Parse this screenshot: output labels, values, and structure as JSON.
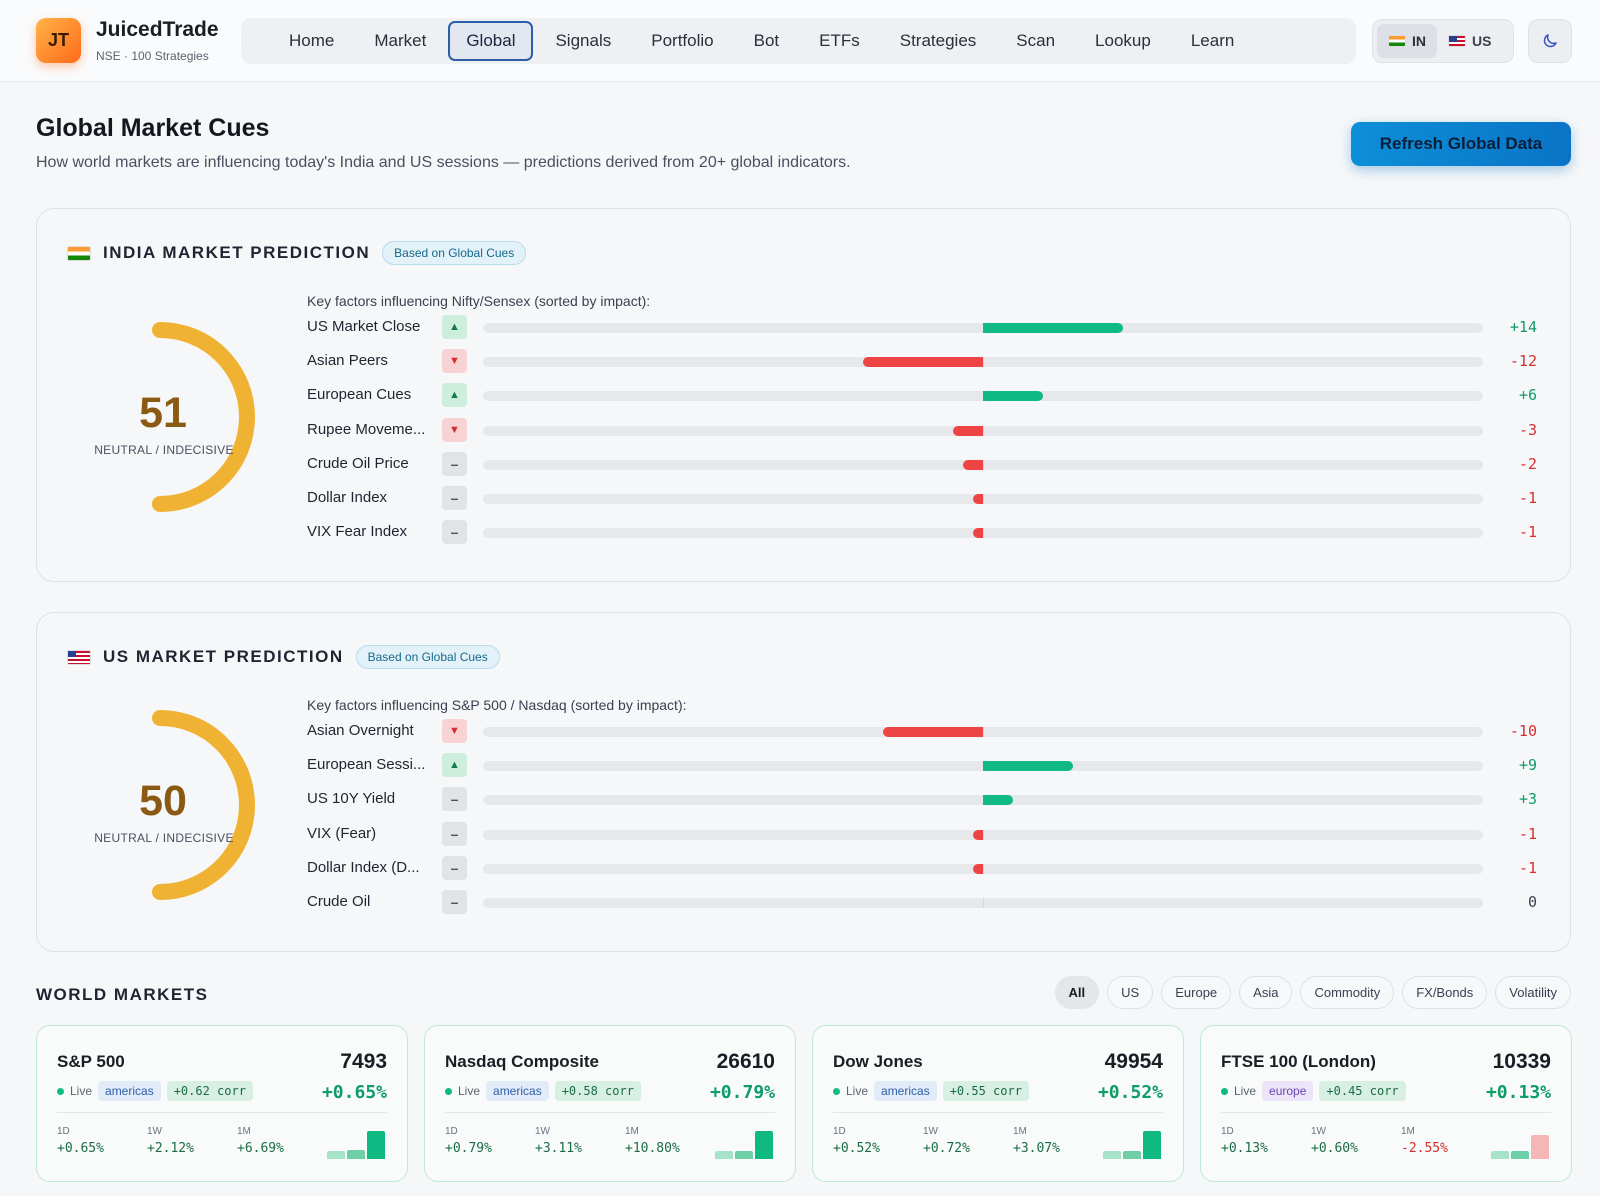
{
  "brand": {
    "logo": "JT",
    "title": "JuicedTrade",
    "subtitle": "NSE · 100 Strategies"
  },
  "nav": {
    "items": [
      {
        "label": "Home",
        "active": false
      },
      {
        "label": "Market",
        "active": false
      },
      {
        "label": "Global",
        "active": true
      },
      {
        "label": "Signals",
        "active": false
      },
      {
        "label": "Portfolio",
        "active": false
      },
      {
        "label": "Bot",
        "active": false
      },
      {
        "label": "ETFs",
        "active": false
      },
      {
        "label": "Strategies",
        "active": false
      },
      {
        "label": "Scan",
        "active": false
      },
      {
        "label": "Lookup",
        "active": false
      },
      {
        "label": "Learn",
        "active": false
      }
    ]
  },
  "market_switch": {
    "in_label": "IN",
    "us_label": "US",
    "selected": "IN"
  },
  "theme_toggle": {
    "icon": "moon-icon"
  },
  "page": {
    "title": "Global Market Cues",
    "subtitle": "How world markets are influencing today's India and US sessions — predictions derived from 20+ global indicators.",
    "refresh_label": "Refresh Global Data"
  },
  "india_prediction": {
    "title": "INDIA MARKET PREDICTION",
    "badge": "Based on Global Cues",
    "score": "51",
    "score_label": "NEUTRAL / INDECISIVE",
    "caption": "Key factors influencing Nifty/Sensex (sorted by impact):",
    "factors": [
      {
        "name": "US Market Close",
        "direction": "up",
        "value": 14,
        "display": "+14"
      },
      {
        "name": "Asian Peers",
        "direction": "down",
        "value": -12,
        "display": "-12"
      },
      {
        "name": "European Cues",
        "direction": "up",
        "value": 6,
        "display": "+6"
      },
      {
        "name": "Rupee Moveme...",
        "direction": "down",
        "value": -3,
        "display": "-3"
      },
      {
        "name": "Crude Oil Price",
        "direction": "flat",
        "value": -2,
        "display": "-2"
      },
      {
        "name": "Dollar Index",
        "direction": "flat",
        "value": -1,
        "display": "-1"
      },
      {
        "name": "VIX Fear Index",
        "direction": "flat",
        "value": -1,
        "display": "-1"
      }
    ]
  },
  "us_prediction": {
    "title": "US MARKET PREDICTION",
    "badge": "Based on Global Cues",
    "score": "50",
    "score_label": "NEUTRAL / INDECISIVE",
    "caption": "Key factors influencing S&P 500 / Nasdaq (sorted by impact):",
    "factors": [
      {
        "name": "Asian Overnight",
        "direction": "down",
        "value": -10,
        "display": "-10"
      },
      {
        "name": "European Sessi...",
        "direction": "up",
        "value": 9,
        "display": "+9"
      },
      {
        "name": "US 10Y Yield",
        "direction": "flat",
        "value": 3,
        "display": "+3"
      },
      {
        "name": "VIX (Fear)",
        "direction": "flat",
        "value": -1,
        "display": "-1"
      },
      {
        "name": "Dollar Index (D...",
        "direction": "flat",
        "value": -1,
        "display": "-1"
      },
      {
        "name": "Crude Oil",
        "direction": "flat",
        "value": 0,
        "display": "0"
      }
    ]
  },
  "world_markets": {
    "title": "WORLD MARKETS",
    "filters": [
      "All",
      "US",
      "Europe",
      "Asia",
      "Commodity",
      "FX/Bonds",
      "Volatility"
    ],
    "active_filter": "All",
    "live_label": "Live",
    "period_labels": [
      "1D",
      "1W",
      "1M"
    ],
    "cards": [
      {
        "name": "S&P 500",
        "price": "7493",
        "region": "americas",
        "corr": "+0.62 corr",
        "change": "+0.65%",
        "periods": [
          "+0.65%",
          "+2.12%",
          "+6.69%"
        ],
        "spark": [
          0.65,
          2.12,
          6.69
        ]
      },
      {
        "name": "Nasdaq Composite",
        "price": "26610",
        "region": "americas",
        "corr": "+0.58 corr",
        "change": "+0.79%",
        "periods": [
          "+0.79%",
          "+3.11%",
          "+10.80%"
        ],
        "spark": [
          0.79,
          3.11,
          10.8
        ]
      },
      {
        "name": "Dow Jones",
        "price": "49954",
        "region": "americas",
        "corr": "+0.55 corr",
        "change": "+0.52%",
        "periods": [
          "+0.52%",
          "+0.72%",
          "+3.07%"
        ],
        "spark": [
          0.52,
          0.72,
          3.07
        ]
      },
      {
        "name": "FTSE 100 (London)",
        "price": "10339",
        "region": "europe",
        "corr": "+0.45 corr",
        "change": "+0.13%",
        "periods": [
          "+0.13%",
          "+0.60%",
          "-2.55%"
        ],
        "spark": [
          0.13,
          0.6,
          -2.55
        ]
      }
    ]
  },
  "colors": {
    "positive": "#10b981",
    "negative": "#ef4444",
    "gauge": "#f0b232",
    "accent": "#0a74c6"
  }
}
